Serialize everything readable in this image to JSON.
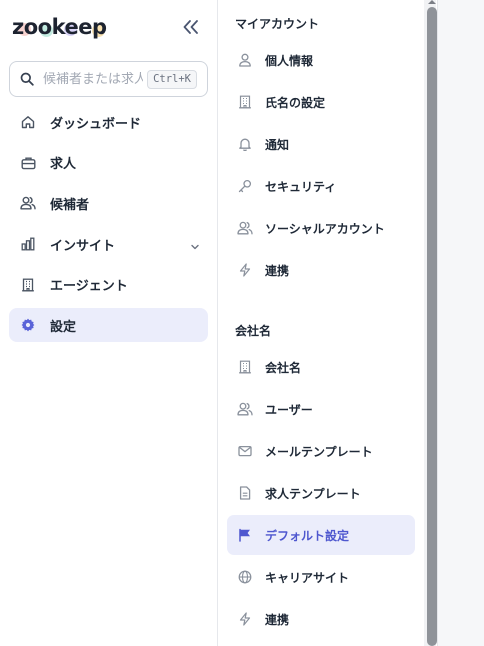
{
  "app": {
    "logo_text": "zookeep"
  },
  "search": {
    "placeholder": "候補者または求人",
    "shortcut": "Ctrl+K"
  },
  "sidebar": {
    "items": [
      {
        "label": "ダッシュボード",
        "icon": "home-icon"
      },
      {
        "label": "求人",
        "icon": "briefcase-icon"
      },
      {
        "label": "候補者",
        "icon": "users-icon"
      },
      {
        "label": "インサイト",
        "icon": "bar-chart-icon",
        "has_chevron": true
      },
      {
        "label": "エージェント",
        "icon": "building-icon"
      },
      {
        "label": "設定",
        "icon": "gear-icon",
        "active": true
      }
    ]
  },
  "settings_nav": {
    "sections": [
      {
        "title": "マイアカウント",
        "items": [
          {
            "label": "個人情報",
            "icon": "user-icon"
          },
          {
            "label": "氏名の設定",
            "icon": "building-icon"
          },
          {
            "label": "通知",
            "icon": "bell-icon"
          },
          {
            "label": "セキュリティ",
            "icon": "key-icon"
          },
          {
            "label": "ソーシャルアカウント",
            "icon": "users-icon"
          },
          {
            "label": "連携",
            "icon": "bolt-icon"
          }
        ]
      },
      {
        "title": "会社名",
        "items": [
          {
            "label": "会社名",
            "icon": "building-icon"
          },
          {
            "label": "ユーザー",
            "icon": "users-icon"
          },
          {
            "label": "メールテンプレート",
            "icon": "mail-icon"
          },
          {
            "label": "求人テンプレート",
            "icon": "document-icon"
          },
          {
            "label": "デフォルト設定",
            "icon": "flag-icon",
            "active": true
          },
          {
            "label": "キャリアサイト",
            "icon": "globe-icon"
          },
          {
            "label": "連携",
            "icon": "bolt-icon"
          }
        ]
      }
    ]
  },
  "colors": {
    "accent": "#5a63d8",
    "active_bg": "#ebedfb"
  }
}
